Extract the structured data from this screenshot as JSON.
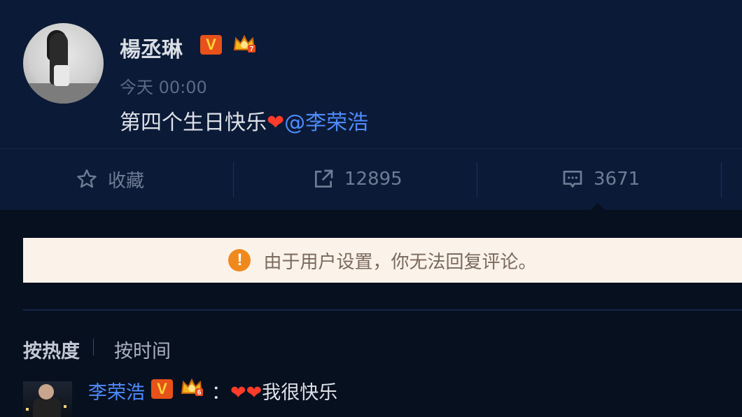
{
  "post": {
    "username": "楊丞琳",
    "verified_badge": "V",
    "member_level": "7",
    "time": "今天 00:00",
    "text": "第四个生日快乐",
    "heart": "❤",
    "mention": "@李荣浩"
  },
  "actions": {
    "favorite_label": "收藏",
    "repost_count": "12895",
    "comment_count": "3671"
  },
  "notice": {
    "icon": "!",
    "text": "由于用户设置，你无法回复评论。"
  },
  "sort": {
    "hot": "按热度",
    "time": "按时间"
  },
  "comment": {
    "username": "李荣浩",
    "verified_badge": "V",
    "member_level": "6",
    "colon": "：",
    "hearts": "❤❤",
    "text": "我很快乐"
  },
  "colors": {
    "background": "#0a1730",
    "link_blue": "#4f8bff",
    "badge_orange": "#e6521a",
    "notice_bg": "#fbf2ea",
    "warning_orange": "#f0891d",
    "heart_red": "#ff3b2a"
  }
}
